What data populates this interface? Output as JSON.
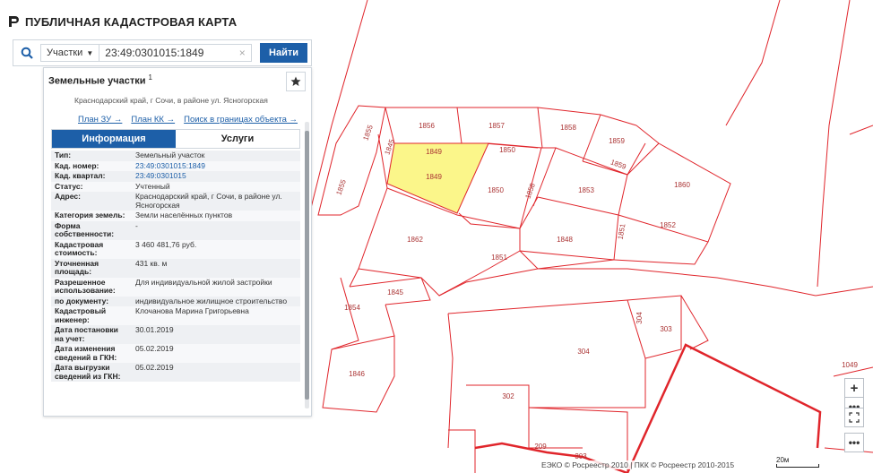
{
  "app": {
    "title": "ПУБЛИЧНАЯ КАДАСТРОВАЯ КАРТА"
  },
  "search": {
    "type_label": "Участки",
    "value": "23:49:0301015:1849",
    "find_label": "Найти"
  },
  "panel": {
    "title": "Земельные участки",
    "count": "1",
    "address_snippet": "Краснодарский край, г Сочи, в районе ул. Ясногорская",
    "links": [
      "План ЗУ →",
      "План КК →",
      "Поиск в границах объекта →"
    ],
    "tabs": [
      "Информация",
      "Услуги"
    ],
    "rows": [
      {
        "key": "Тип:",
        "value": "Земельный участок"
      },
      {
        "key": "Кад. номер:",
        "value": "23:49:0301015:1849"
      },
      {
        "key": "Кад. квартал:",
        "value": "23:49:0301015"
      },
      {
        "key": "Статус:",
        "value": "Учтенный"
      },
      {
        "key": "Адрес:",
        "value": "Краснодарский край, г Сочи, в районе ул. Ясногорская"
      },
      {
        "key": "Категория земель:",
        "value": "Земли населённых пунктов"
      },
      {
        "key": "Форма собственности:",
        "value": "-"
      },
      {
        "key": "Кадастровая стоимость:",
        "value": "3 460 481,76 руб."
      },
      {
        "key": "Уточненная площадь:",
        "value": "431 кв. м"
      },
      {
        "key": "Разрешенное использование:",
        "value": "Для индивидуальной жилой застройки"
      },
      {
        "key": "по документу:",
        "value": "индивидуальное жилищное строительство"
      },
      {
        "key": "Кадастровый инженер:",
        "value": "Клочанова Марина Григорьевна"
      },
      {
        "key": "Дата постановки на учет:",
        "value": "30.01.2019"
      },
      {
        "key": "Дата изменения сведений в ГКН:",
        "value": "05.02.2019"
      },
      {
        "key": "Дата выгрузки сведений из ГКН:",
        "value": "05.02.2019"
      }
    ]
  },
  "map": {
    "parcel_labels": [
      "1856",
      "1857",
      "1858",
      "1855",
      "1845",
      "1849",
      "1850",
      "1859",
      "1859",
      "1849",
      "1850",
      "1858",
      "1853",
      "1860",
      "1855",
      "1862",
      "1851",
      "1851",
      "1852",
      "1848",
      "1845",
      "1854",
      "304",
      "303",
      "304",
      "1846",
      "302",
      "209",
      "303",
      "1049"
    ],
    "attribution": "ЕЭКО © Росреестр 2010 | ПКК © Росреестр 2010-2015",
    "scale_label": "20м",
    "zoom_in": "+",
    "more_1": "•••",
    "more_2": "•••",
    "colors": {
      "parcel_line": "#e0252b",
      "selected_fill": "#fbf68a",
      "accent": "#1d5fa8"
    }
  }
}
